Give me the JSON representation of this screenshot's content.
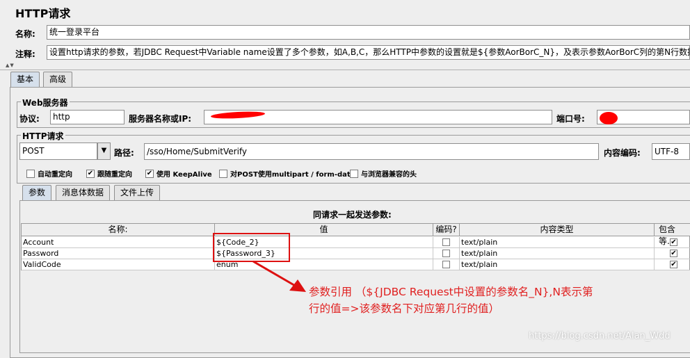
{
  "header": {
    "title": "HTTP请求"
  },
  "name_row": {
    "label": "名称:",
    "value": "统一登录平台"
  },
  "comment_row": {
    "label": "注释:",
    "value": "设置http请求的参数，若JDBC Request中Variable name设置了多个参数，如A,B,C，那么HTTP中参数的设置就是${参数AorBorC_N}，及表示参数AorBorC列的第N行数据值"
  },
  "tabs": [
    {
      "label": "基本"
    },
    {
      "label": "高级"
    }
  ],
  "web_server": {
    "group_title": "Web服务器",
    "protocol_label": "协议:",
    "protocol_value": "http",
    "server_label": "服务器名称或IP:",
    "server_value": "",
    "port_label": "端口号:",
    "port_value": ""
  },
  "http_request": {
    "group_title": "HTTP请求",
    "method_value": "POST",
    "path_label": "路径:",
    "path_value": "/sso/Home/SubmitVerify",
    "encoding_label": "内容编码:",
    "encoding_value": "UTF-8"
  },
  "options": [
    {
      "label": "自动重定向",
      "checked": false
    },
    {
      "label": "跟随重定向",
      "checked": true
    },
    {
      "label": "使用 KeepAlive",
      "checked": true
    },
    {
      "label": "对POST使用multipart / form-data",
      "checked": false
    },
    {
      "label": "与浏览器兼容的头",
      "checked": false
    }
  ],
  "sub_tabs": [
    {
      "label": "参数"
    },
    {
      "label": "消息体数据"
    },
    {
      "label": "文件上传"
    }
  ],
  "params": {
    "caption": "同请求一起发送参数:",
    "columns": [
      "名称:",
      "值",
      "编码?",
      "内容类型",
      "包含等..."
    ],
    "rows": [
      {
        "name": "Account",
        "value": "${Code_2}",
        "encode": false,
        "content_type": "text/plain",
        "include_eq": true
      },
      {
        "name": "Password",
        "value": "${Password_3}",
        "encode": false,
        "content_type": "text/plain",
        "include_eq": true
      },
      {
        "name": "ValidCode",
        "value": "enum",
        "encode": false,
        "content_type": "text/plain",
        "include_eq": true
      }
    ]
  },
  "annotation": {
    "line1": "参数引用 （${JDBC Request中设置的参数名_N},N表示第",
    "line2": "行的值=>该参数名下对应第几行的值）"
  },
  "watermark": "https://blog.csdn.net/Alan_Wdd",
  "colors": {
    "annotation_red": "#e02020",
    "highlight_box": "#dd1111"
  }
}
